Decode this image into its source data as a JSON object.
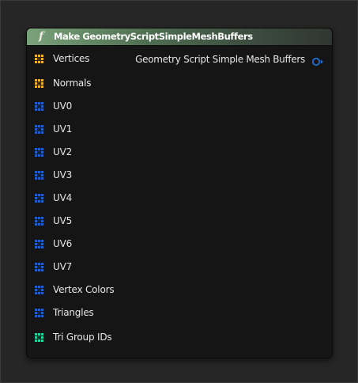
{
  "node": {
    "title": "Make GeometryScriptSimpleMeshBuffers",
    "icon": "function-icon",
    "header_color": "#5b7f5d",
    "output": {
      "label": "Geometry Script Simple Mesh Buffers",
      "icon": "struct-pin-icon",
      "color": "#1e6fd0"
    },
    "inputs": [
      {
        "label": "Vertices",
        "icon": "vector-array-pin-icon",
        "color": "#f0b22a"
      },
      {
        "label": "Normals",
        "icon": "vector-array-pin-icon",
        "color": "#f0b22a"
      },
      {
        "label": "UV0",
        "icon": "vector2d-array-pin-icon",
        "color": "#1e5fd0"
      },
      {
        "label": "UV1",
        "icon": "vector2d-array-pin-icon",
        "color": "#1e5fd0"
      },
      {
        "label": "UV2",
        "icon": "vector2d-array-pin-icon",
        "color": "#1e5fd0"
      },
      {
        "label": "UV3",
        "icon": "vector2d-array-pin-icon",
        "color": "#1e5fd0"
      },
      {
        "label": "UV4",
        "icon": "vector2d-array-pin-icon",
        "color": "#1e5fd0"
      },
      {
        "label": "UV5",
        "icon": "vector2d-array-pin-icon",
        "color": "#1e5fd0"
      },
      {
        "label": "UV6",
        "icon": "vector2d-array-pin-icon",
        "color": "#1e5fd0"
      },
      {
        "label": "UV7",
        "icon": "vector2d-array-pin-icon",
        "color": "#1e5fd0"
      },
      {
        "label": "Vertex Colors",
        "icon": "linear-color-array-pin-icon",
        "color": "#1e5fd0"
      },
      {
        "label": "Triangles",
        "icon": "int-vector-array-pin-icon",
        "color": "#1e5fd0"
      },
      {
        "label": "Tri Group IDs",
        "icon": "integer-array-pin-icon",
        "color": "#1fd8a0"
      }
    ]
  }
}
